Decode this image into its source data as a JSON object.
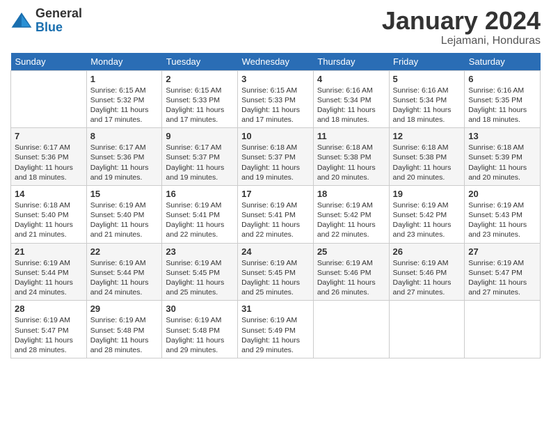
{
  "logo": {
    "general": "General",
    "blue": "Blue"
  },
  "title": "January 2024",
  "location": "Lejamani, Honduras",
  "days_of_week": [
    "Sunday",
    "Monday",
    "Tuesday",
    "Wednesday",
    "Thursday",
    "Friday",
    "Saturday"
  ],
  "weeks": [
    [
      {
        "day": "",
        "info": ""
      },
      {
        "day": "1",
        "info": "Sunrise: 6:15 AM\nSunset: 5:32 PM\nDaylight: 11 hours\nand 17 minutes."
      },
      {
        "day": "2",
        "info": "Sunrise: 6:15 AM\nSunset: 5:33 PM\nDaylight: 11 hours\nand 17 minutes."
      },
      {
        "day": "3",
        "info": "Sunrise: 6:15 AM\nSunset: 5:33 PM\nDaylight: 11 hours\nand 17 minutes."
      },
      {
        "day": "4",
        "info": "Sunrise: 6:16 AM\nSunset: 5:34 PM\nDaylight: 11 hours\nand 18 minutes."
      },
      {
        "day": "5",
        "info": "Sunrise: 6:16 AM\nSunset: 5:34 PM\nDaylight: 11 hours\nand 18 minutes."
      },
      {
        "day": "6",
        "info": "Sunrise: 6:16 AM\nSunset: 5:35 PM\nDaylight: 11 hours\nand 18 minutes."
      }
    ],
    [
      {
        "day": "7",
        "info": "Sunrise: 6:17 AM\nSunset: 5:36 PM\nDaylight: 11 hours\nand 18 minutes."
      },
      {
        "day": "8",
        "info": "Sunrise: 6:17 AM\nSunset: 5:36 PM\nDaylight: 11 hours\nand 19 minutes."
      },
      {
        "day": "9",
        "info": "Sunrise: 6:17 AM\nSunset: 5:37 PM\nDaylight: 11 hours\nand 19 minutes."
      },
      {
        "day": "10",
        "info": "Sunrise: 6:18 AM\nSunset: 5:37 PM\nDaylight: 11 hours\nand 19 minutes."
      },
      {
        "day": "11",
        "info": "Sunrise: 6:18 AM\nSunset: 5:38 PM\nDaylight: 11 hours\nand 20 minutes."
      },
      {
        "day": "12",
        "info": "Sunrise: 6:18 AM\nSunset: 5:38 PM\nDaylight: 11 hours\nand 20 minutes."
      },
      {
        "day": "13",
        "info": "Sunrise: 6:18 AM\nSunset: 5:39 PM\nDaylight: 11 hours\nand 20 minutes."
      }
    ],
    [
      {
        "day": "14",
        "info": "Sunrise: 6:18 AM\nSunset: 5:40 PM\nDaylight: 11 hours\nand 21 minutes."
      },
      {
        "day": "15",
        "info": "Sunrise: 6:19 AM\nSunset: 5:40 PM\nDaylight: 11 hours\nand 21 minutes."
      },
      {
        "day": "16",
        "info": "Sunrise: 6:19 AM\nSunset: 5:41 PM\nDaylight: 11 hours\nand 22 minutes."
      },
      {
        "day": "17",
        "info": "Sunrise: 6:19 AM\nSunset: 5:41 PM\nDaylight: 11 hours\nand 22 minutes."
      },
      {
        "day": "18",
        "info": "Sunrise: 6:19 AM\nSunset: 5:42 PM\nDaylight: 11 hours\nand 22 minutes."
      },
      {
        "day": "19",
        "info": "Sunrise: 6:19 AM\nSunset: 5:42 PM\nDaylight: 11 hours\nand 23 minutes."
      },
      {
        "day": "20",
        "info": "Sunrise: 6:19 AM\nSunset: 5:43 PM\nDaylight: 11 hours\nand 23 minutes."
      }
    ],
    [
      {
        "day": "21",
        "info": "Sunrise: 6:19 AM\nSunset: 5:44 PM\nDaylight: 11 hours\nand 24 minutes."
      },
      {
        "day": "22",
        "info": "Sunrise: 6:19 AM\nSunset: 5:44 PM\nDaylight: 11 hours\nand 24 minutes."
      },
      {
        "day": "23",
        "info": "Sunrise: 6:19 AM\nSunset: 5:45 PM\nDaylight: 11 hours\nand 25 minutes."
      },
      {
        "day": "24",
        "info": "Sunrise: 6:19 AM\nSunset: 5:45 PM\nDaylight: 11 hours\nand 25 minutes."
      },
      {
        "day": "25",
        "info": "Sunrise: 6:19 AM\nSunset: 5:46 PM\nDaylight: 11 hours\nand 26 minutes."
      },
      {
        "day": "26",
        "info": "Sunrise: 6:19 AM\nSunset: 5:46 PM\nDaylight: 11 hours\nand 27 minutes."
      },
      {
        "day": "27",
        "info": "Sunrise: 6:19 AM\nSunset: 5:47 PM\nDaylight: 11 hours\nand 27 minutes."
      }
    ],
    [
      {
        "day": "28",
        "info": "Sunrise: 6:19 AM\nSunset: 5:47 PM\nDaylight: 11 hours\nand 28 minutes."
      },
      {
        "day": "29",
        "info": "Sunrise: 6:19 AM\nSunset: 5:48 PM\nDaylight: 11 hours\nand 28 minutes."
      },
      {
        "day": "30",
        "info": "Sunrise: 6:19 AM\nSunset: 5:48 PM\nDaylight: 11 hours\nand 29 minutes."
      },
      {
        "day": "31",
        "info": "Sunrise: 6:19 AM\nSunset: 5:49 PM\nDaylight: 11 hours\nand 29 minutes."
      },
      {
        "day": "",
        "info": ""
      },
      {
        "day": "",
        "info": ""
      },
      {
        "day": "",
        "info": ""
      }
    ]
  ]
}
